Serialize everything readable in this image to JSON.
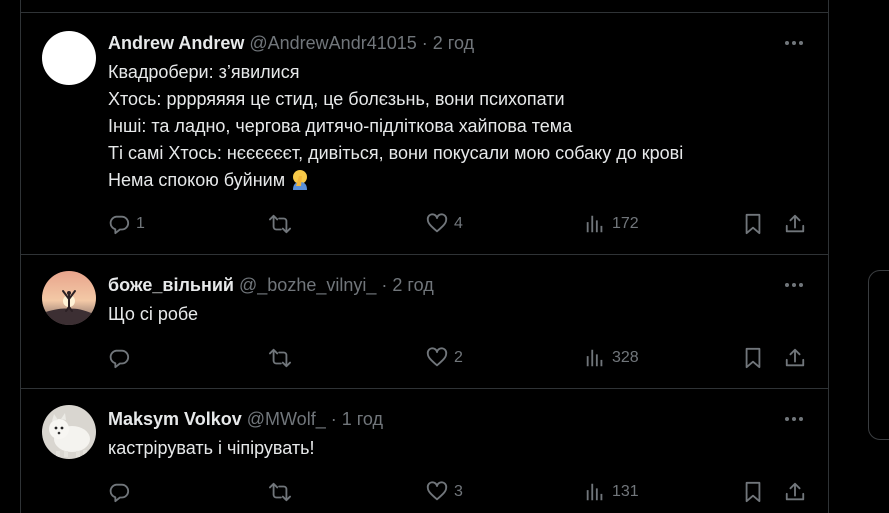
{
  "tweets": [
    {
      "name": "Andrew Andrew",
      "handle": "@AndrewAndr41015",
      "separator": "·",
      "time": "2 год",
      "lines": [
        "Квадробери: з’явилися",
        "Хтось: рррряяяя це стид, це болєзьнь, вони психопати",
        "Інші: та ладно, чергова дитячо-підліткова хайпова тема",
        "Ті самі Хтось: нєєєєєєт, дивіться, вони покусали мою собаку до крові",
        "Нема спокою буйним"
      ],
      "emoji": "facepalm-emoji",
      "replies": "1",
      "reposts": "",
      "likes": "4",
      "views": "172"
    },
    {
      "name": "боже_вільний",
      "handle": "@_bozhe_vilnyi_",
      "separator": "·",
      "time": "2 год",
      "lines": [
        "Що сі робе"
      ],
      "replies": "",
      "reposts": "",
      "likes": "2",
      "views": "328"
    },
    {
      "name": "Maksym Volkov",
      "handle": "@MWolf_",
      "separator": "·",
      "time": "1 год",
      "lines": [
        "кастрірувать і чіпірувать!"
      ],
      "replies": "",
      "reposts": "",
      "likes": "3",
      "views": "131"
    }
  ],
  "icons": {
    "reply": "reply-icon",
    "repost": "repost-icon",
    "like": "heart-icon",
    "views": "views-icon",
    "bookmark": "bookmark-icon",
    "share": "share-icon",
    "more": "more-icon"
  },
  "colors": {
    "background": "#000000",
    "text": "#e7e9ea",
    "secondary": "#71767b",
    "border": "#2f3336"
  }
}
